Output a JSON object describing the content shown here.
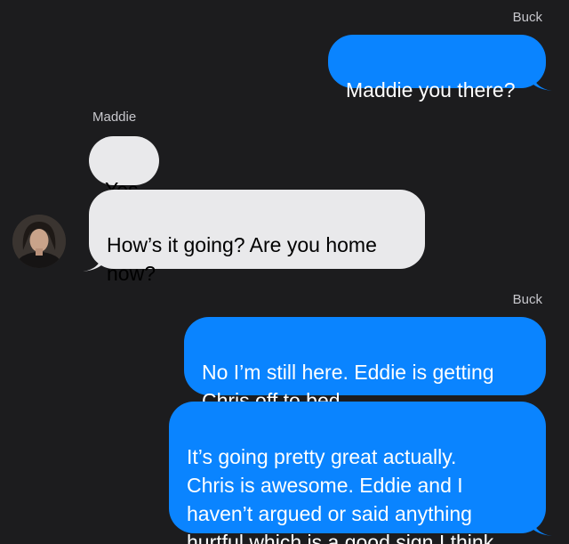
{
  "conversation": {
    "messages": [
      {
        "sender": "Buck",
        "text": "Maddie you there?"
      },
      {
        "sender": "Maddie",
        "text": "Yes"
      },
      {
        "text": "How’s it going? Are you home\nnow?"
      },
      {
        "sender": "Buck",
        "text": "No I’m still here. Eddie is getting\nChris off to bed."
      },
      {
        "text": "It’s going pretty great actually.\nChris is awesome. Eddie and I\nhaven’t argued or said anything\nhurtful which is a good sign I think"
      }
    ]
  },
  "colors": {
    "background": "#1c1c1e",
    "outgoing_bubble": "#0a84ff",
    "incoming_bubble": "#e9e9eb",
    "sender_label": "#c7c7cc"
  },
  "icons": {
    "avatar": "contact-photo-maddie"
  }
}
